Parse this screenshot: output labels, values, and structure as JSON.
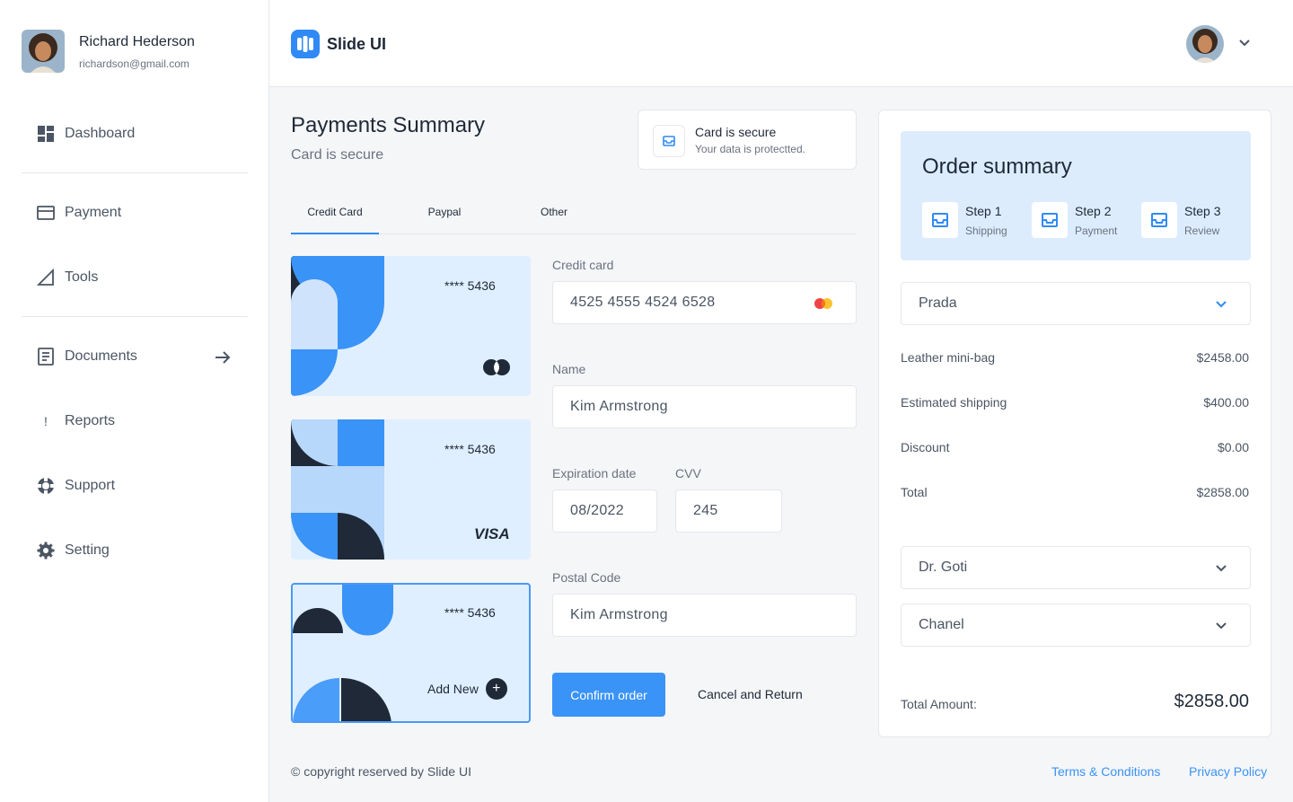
{
  "user": {
    "name": "Richard Hederson",
    "email": "richardson@gmail.com"
  },
  "sidebar": {
    "items": [
      {
        "label": "Dashboard",
        "icon": "dashboard-icon"
      },
      {
        "label": "Payment",
        "icon": "credit-card-icon"
      },
      {
        "label": "Tools",
        "icon": "ruler-triangle-icon"
      },
      {
        "label": "Documents",
        "icon": "document-icon"
      },
      {
        "label": "Reports",
        "icon": "exclamation-icon"
      },
      {
        "label": "Support",
        "icon": "lifebuoy-icon"
      },
      {
        "label": "Setting",
        "icon": "gear-icon"
      }
    ]
  },
  "header": {
    "app_name": "Slide UI"
  },
  "main": {
    "title": "Payments Summary",
    "subtitle": "Card is secure",
    "secure": {
      "title": "Card is secure",
      "subtitle": "Your data is protectted."
    },
    "tabs": [
      {
        "label": "Credit Card",
        "active": true
      },
      {
        "label": "Paypal",
        "active": false
      },
      {
        "label": "Other",
        "active": false
      }
    ],
    "cards": [
      {
        "number": "****  5436",
        "brand": "mastercard"
      },
      {
        "number": "****  5436",
        "brand": "VISA"
      },
      {
        "number": "****  5436",
        "add_label": "Add New",
        "add_symbol": "+"
      }
    ],
    "form": {
      "credit_card_label": "Credit card",
      "credit_card_value": "4525 4555 4524 6528",
      "name_label": "Name",
      "name_value": "Kim Armstrong",
      "expiration_label": "Expiration date",
      "expiration_value": "08/2022",
      "cvv_label": "CVV",
      "cvv_value": "245",
      "postal_label": "Postal Code",
      "postal_value": "Kim Armstrong"
    },
    "confirm_label": "Confirm order",
    "cancel_label": "Cancel and Return"
  },
  "order": {
    "title": "Order summary",
    "steps": [
      {
        "title": "Step 1",
        "subtitle": "Shipping"
      },
      {
        "title": "Step 2",
        "subtitle": "Payment"
      },
      {
        "title": "Step 3",
        "subtitle": "Review"
      }
    ],
    "brand_select": "Prada",
    "lines": [
      {
        "label": "Leather mini-bag",
        "value": "$2458.00"
      },
      {
        "label": "Estimated shipping",
        "value": "$400.00"
      },
      {
        "label": "Discount",
        "value": "$0.00"
      },
      {
        "label": "Total",
        "value": "$2858.00"
      }
    ],
    "select_2": "Dr. Goti",
    "select_3": "Chanel",
    "total_amount_label": "Total Amount:",
    "total_amount_value": "$2858.00"
  },
  "footer": {
    "copyright": "© copyright reserved by Slide UI",
    "terms": "Terms & Conditions",
    "privacy": "Privacy Policy"
  },
  "colors": {
    "accent": "#3a93f7",
    "card_bg": "#e0efff",
    "dark": "#1f2937"
  }
}
